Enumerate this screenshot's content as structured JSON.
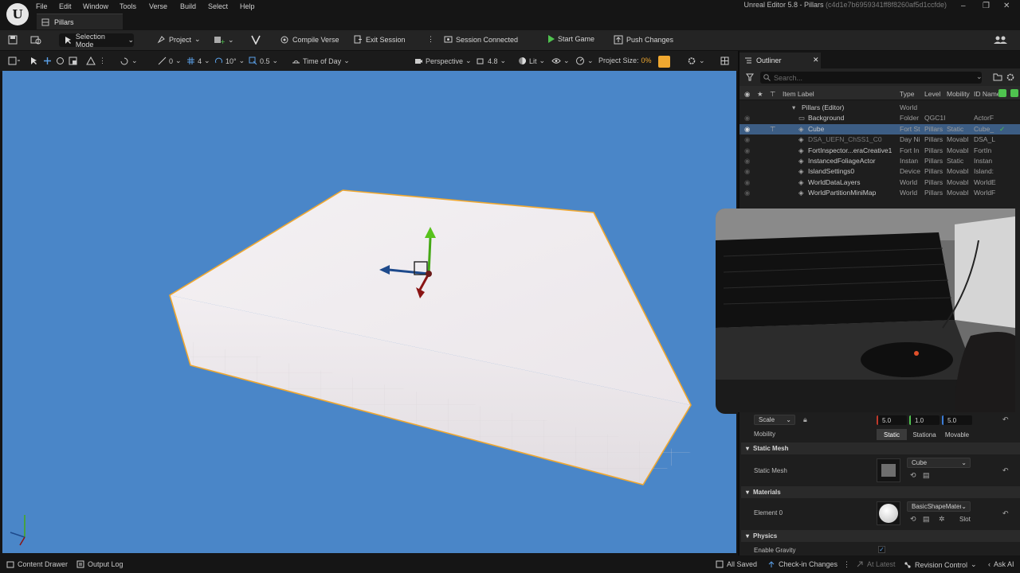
{
  "menubar": {
    "logo_letter": "U",
    "items": [
      "File",
      "Edit",
      "Window",
      "Tools",
      "Verse",
      "Build",
      "Select",
      "Help"
    ],
    "doc_tab": "Pillars",
    "title": "Unreal Editor 5.8 - Pillars",
    "title_hash": "(c4d1e7b6959341ff8f8260af5d1ccfde)",
    "window_buttons": [
      "–",
      "❐",
      "✕"
    ]
  },
  "toolbar": {
    "selection_mode": "Selection Mode",
    "project": "Project",
    "compile_verse": "Compile Verse",
    "exit_session": "Exit Session",
    "session_status": "Session Connected",
    "start_game": "Start Game",
    "push_changes": "Push Changes"
  },
  "viewport_toolbar": {
    "translate_snap": "0",
    "grid_size": "4",
    "rotate_snap": "10°",
    "scale_snap": "0.5",
    "time_of_day": "Time of Day",
    "perspective": "Perspective",
    "camera_speed": "4.8",
    "view_mode": "Lit",
    "project_size_label": "Project Size:",
    "project_size_value": "0%"
  },
  "outliner": {
    "title": "Outliner",
    "search_placeholder": "Search...",
    "columns": [
      "Item Label",
      "Type",
      "Level",
      "Mobility",
      "ID Name"
    ],
    "rows": [
      {
        "label": "Pillars (Editor)",
        "type": "World",
        "level": "",
        "mobility": "",
        "id": "",
        "indent": 0,
        "selected": false
      },
      {
        "label": "Background",
        "type": "Folder",
        "level": "QGC1I",
        "mobility": "",
        "id": "ActorF",
        "indent": 1,
        "selected": false
      },
      {
        "label": "Cube",
        "type": "Fort St",
        "level": "Pillars",
        "mobility": "Static",
        "id": "Cube_",
        "indent": 1,
        "selected": true
      },
      {
        "label": "DSA_UEFN_ChSS1_C0",
        "type": "Day Ni",
        "level": "Pillars",
        "mobility": "Movabl",
        "id": "DSA_L",
        "indent": 1,
        "selected": false
      },
      {
        "label": "FortInspector...eraCreative1",
        "type": "Fort In",
        "level": "Pillars",
        "mobility": "Movabl",
        "id": "FortIn",
        "indent": 1,
        "selected": false
      },
      {
        "label": "InstancedFoliageActor",
        "type": "Instan",
        "level": "Pillars",
        "mobility": "Static",
        "id": "Instan",
        "indent": 1,
        "selected": false
      },
      {
        "label": "IslandSettings0",
        "type": "Device",
        "level": "Pillars",
        "mobility": "Movabl",
        "id": "Island:",
        "indent": 1,
        "selected": false
      },
      {
        "label": "WorldDataLayers",
        "type": "World",
        "level": "Pillars",
        "mobility": "Movabl",
        "id": "WorldE",
        "indent": 1,
        "selected": false
      },
      {
        "label": "WorldPartitionMiniMap",
        "type": "World",
        "level": "Pillars",
        "mobility": "Movabl",
        "id": "WorldF",
        "indent": 1,
        "selected": false
      }
    ]
  },
  "details": {
    "scale_label": "Scale",
    "scale_x": "5.0",
    "scale_y": "1.0",
    "scale_z": "5.0",
    "mobility_label": "Mobility",
    "mobility_options": [
      "Static",
      "Stationa",
      "Movable"
    ],
    "mobility_selected": "Static",
    "static_mesh_section": "Static Mesh",
    "static_mesh_label": "Static Mesh",
    "static_mesh_value": "Cube",
    "materials_section": "Materials",
    "element0_label": "Element 0",
    "element0_value": "BasicShapeMater",
    "slot_label": "Slot",
    "physics_section": "Physics",
    "enable_gravity_label": "Enable Gravity",
    "enable_gravity": true
  },
  "statusbar": {
    "content_drawer": "Content Drawer",
    "output_log": "Output Log",
    "all_saved": "All Saved",
    "checkin": "Check-in Changes",
    "at_latest": "At Latest",
    "revision_control": "Revision Control",
    "ask_ai": "Ask AI"
  },
  "colors": {
    "sky": "#4a86c8",
    "selection_outline": "#f0a830",
    "selected_row": "#3c5d84",
    "accent_green": "#4fc34f"
  }
}
